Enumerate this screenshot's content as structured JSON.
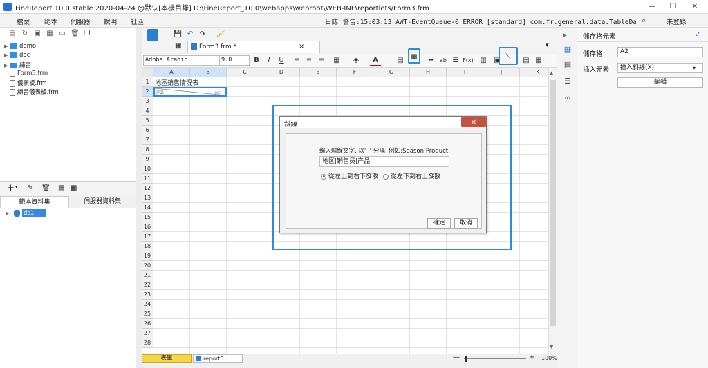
{
  "window": {
    "title": "FineReport 10.0 stable 2020-04-24 @默认[本機目錄]   D:\\FineReport_10.0\\webapps\\webroot\\WEB-INF\\reportlets/Form3.frm",
    "minimize": "—",
    "maximize": "☐",
    "close": "✕"
  },
  "menu": {
    "items": [
      "檔案",
      "範本",
      "伺服器",
      "說明",
      "社區"
    ],
    "log_label": "日誌",
    "log_message": "警告:15:03:13 AWT-EventQueue-0 ERROR [standard] com.fr.general.data.TableDataException: 錯...",
    "login": "未登錄"
  },
  "tree": {
    "items": [
      {
        "label": "demo",
        "type": "folder"
      },
      {
        "label": "doc",
        "type": "folder"
      },
      {
        "label": "練習",
        "type": "folder"
      },
      {
        "label": "Form3.frm",
        "type": "file"
      },
      {
        "label": "儀表板.frm",
        "type": "file"
      },
      {
        "label": "練習儀表板.frm",
        "type": "file"
      }
    ]
  },
  "dataset_tabs": [
    "範本資料集",
    "伺服器資料集"
  ],
  "dataset_items": [
    "ds1"
  ],
  "doc_tab": {
    "label": "Form3.frm *"
  },
  "format_toolbar": {
    "font": "Adobe Arabic",
    "size": "9.0",
    "bold": "B",
    "italic": "I",
    "underline": "U"
  },
  "grid": {
    "columns": [
      "A",
      "B",
      "C",
      "D",
      "E",
      "F",
      "G",
      "H",
      "I",
      "J",
      "K"
    ],
    "rows": [
      "1",
      "2",
      "3",
      "4",
      "5",
      "6",
      "7",
      "8",
      "9",
      "10",
      "11",
      "12",
      "13",
      "14",
      "15",
      "16",
      "17",
      "18",
      "19",
      "20",
      "21",
      "22",
      "23",
      "24",
      "25",
      "26",
      "27",
      "28"
    ],
    "cell_a1": "地區銷售情況表",
    "cell_a2_left": "产品",
    "cell_a2_right": "地区"
  },
  "sheets": {
    "sheet1": "表單",
    "report": "report0"
  },
  "zoom": {
    "minus": "—",
    "plus": "+",
    "value": "100%"
  },
  "right_panel": {
    "title": "儲存格元素",
    "cell_label": "儲存格",
    "cell_value": "A2",
    "insert_label": "插入元素",
    "insert_value": "插入斜線(X)",
    "edit_button": "編輯"
  },
  "dialog": {
    "title": "斜線",
    "instruction": "輸入斜線文字, 以' |' 分隔, 例如:Season|Product",
    "input_value": "地区|销售员|产品",
    "option1": "從左上到右下發散",
    "option2": "從左下到右上發散",
    "ok": "確定",
    "cancel": "取消"
  }
}
